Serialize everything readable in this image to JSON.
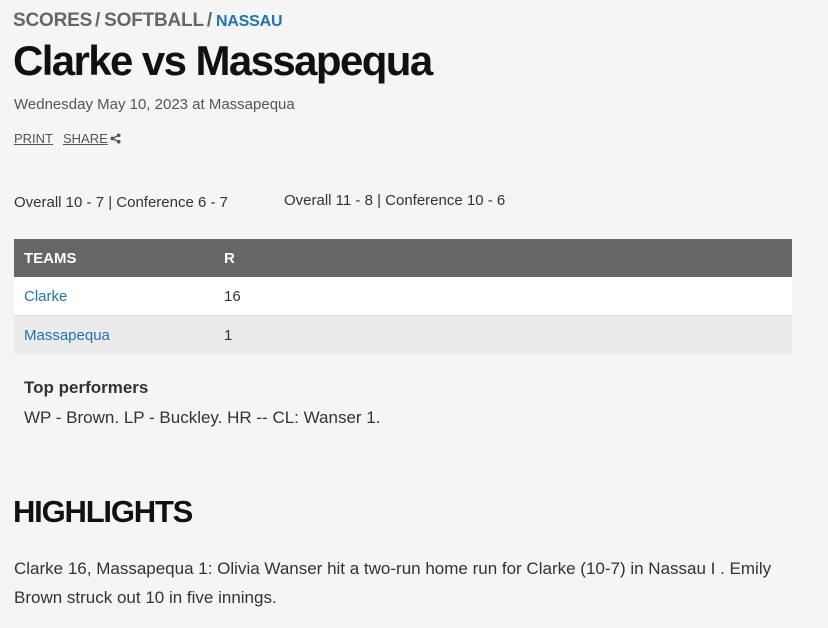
{
  "breadcrumb": {
    "scores": "SCORES",
    "sep1": "/",
    "sport": "SOFTBALL",
    "sep2": "/",
    "region": "NASSAU"
  },
  "game": {
    "title": "Clarke vs Massapequa",
    "dateline": "Wednesday May 10, 2023 at Massapequa"
  },
  "actions": {
    "print": "PRINT",
    "share": "SHARE"
  },
  "records": [
    {
      "team": "Clarke",
      "text": "Overall 10 - 7 | Conference 6 - 7"
    },
    {
      "team": "Massapequa",
      "text": "Overall 11 - 8 | Conference 10 - 6"
    }
  ],
  "score_table": {
    "headers": {
      "teams": "TEAMS",
      "runs": "R"
    },
    "rows": [
      {
        "team": "Clarke",
        "runs": "16"
      },
      {
        "team": "Massapequa",
        "runs": "1"
      }
    ]
  },
  "performers": {
    "title": "Top performers",
    "text": "WP - Brown. LP - Buckley. HR -- CL: Wanser 1."
  },
  "highlights": {
    "title": "HIGHLIGHTS",
    "body": "Clarke 16, Massapequa 1: Olivia Wanser hit a two-run home run for Clarke (10-7) in Nassau I . Emily Brown struck out 10 in five innings."
  },
  "colors": {
    "link": "#1f73b7",
    "header_bg": "#666666",
    "page_bg": "#f5f5f5"
  },
  "icons": {
    "share": "share-icon"
  }
}
